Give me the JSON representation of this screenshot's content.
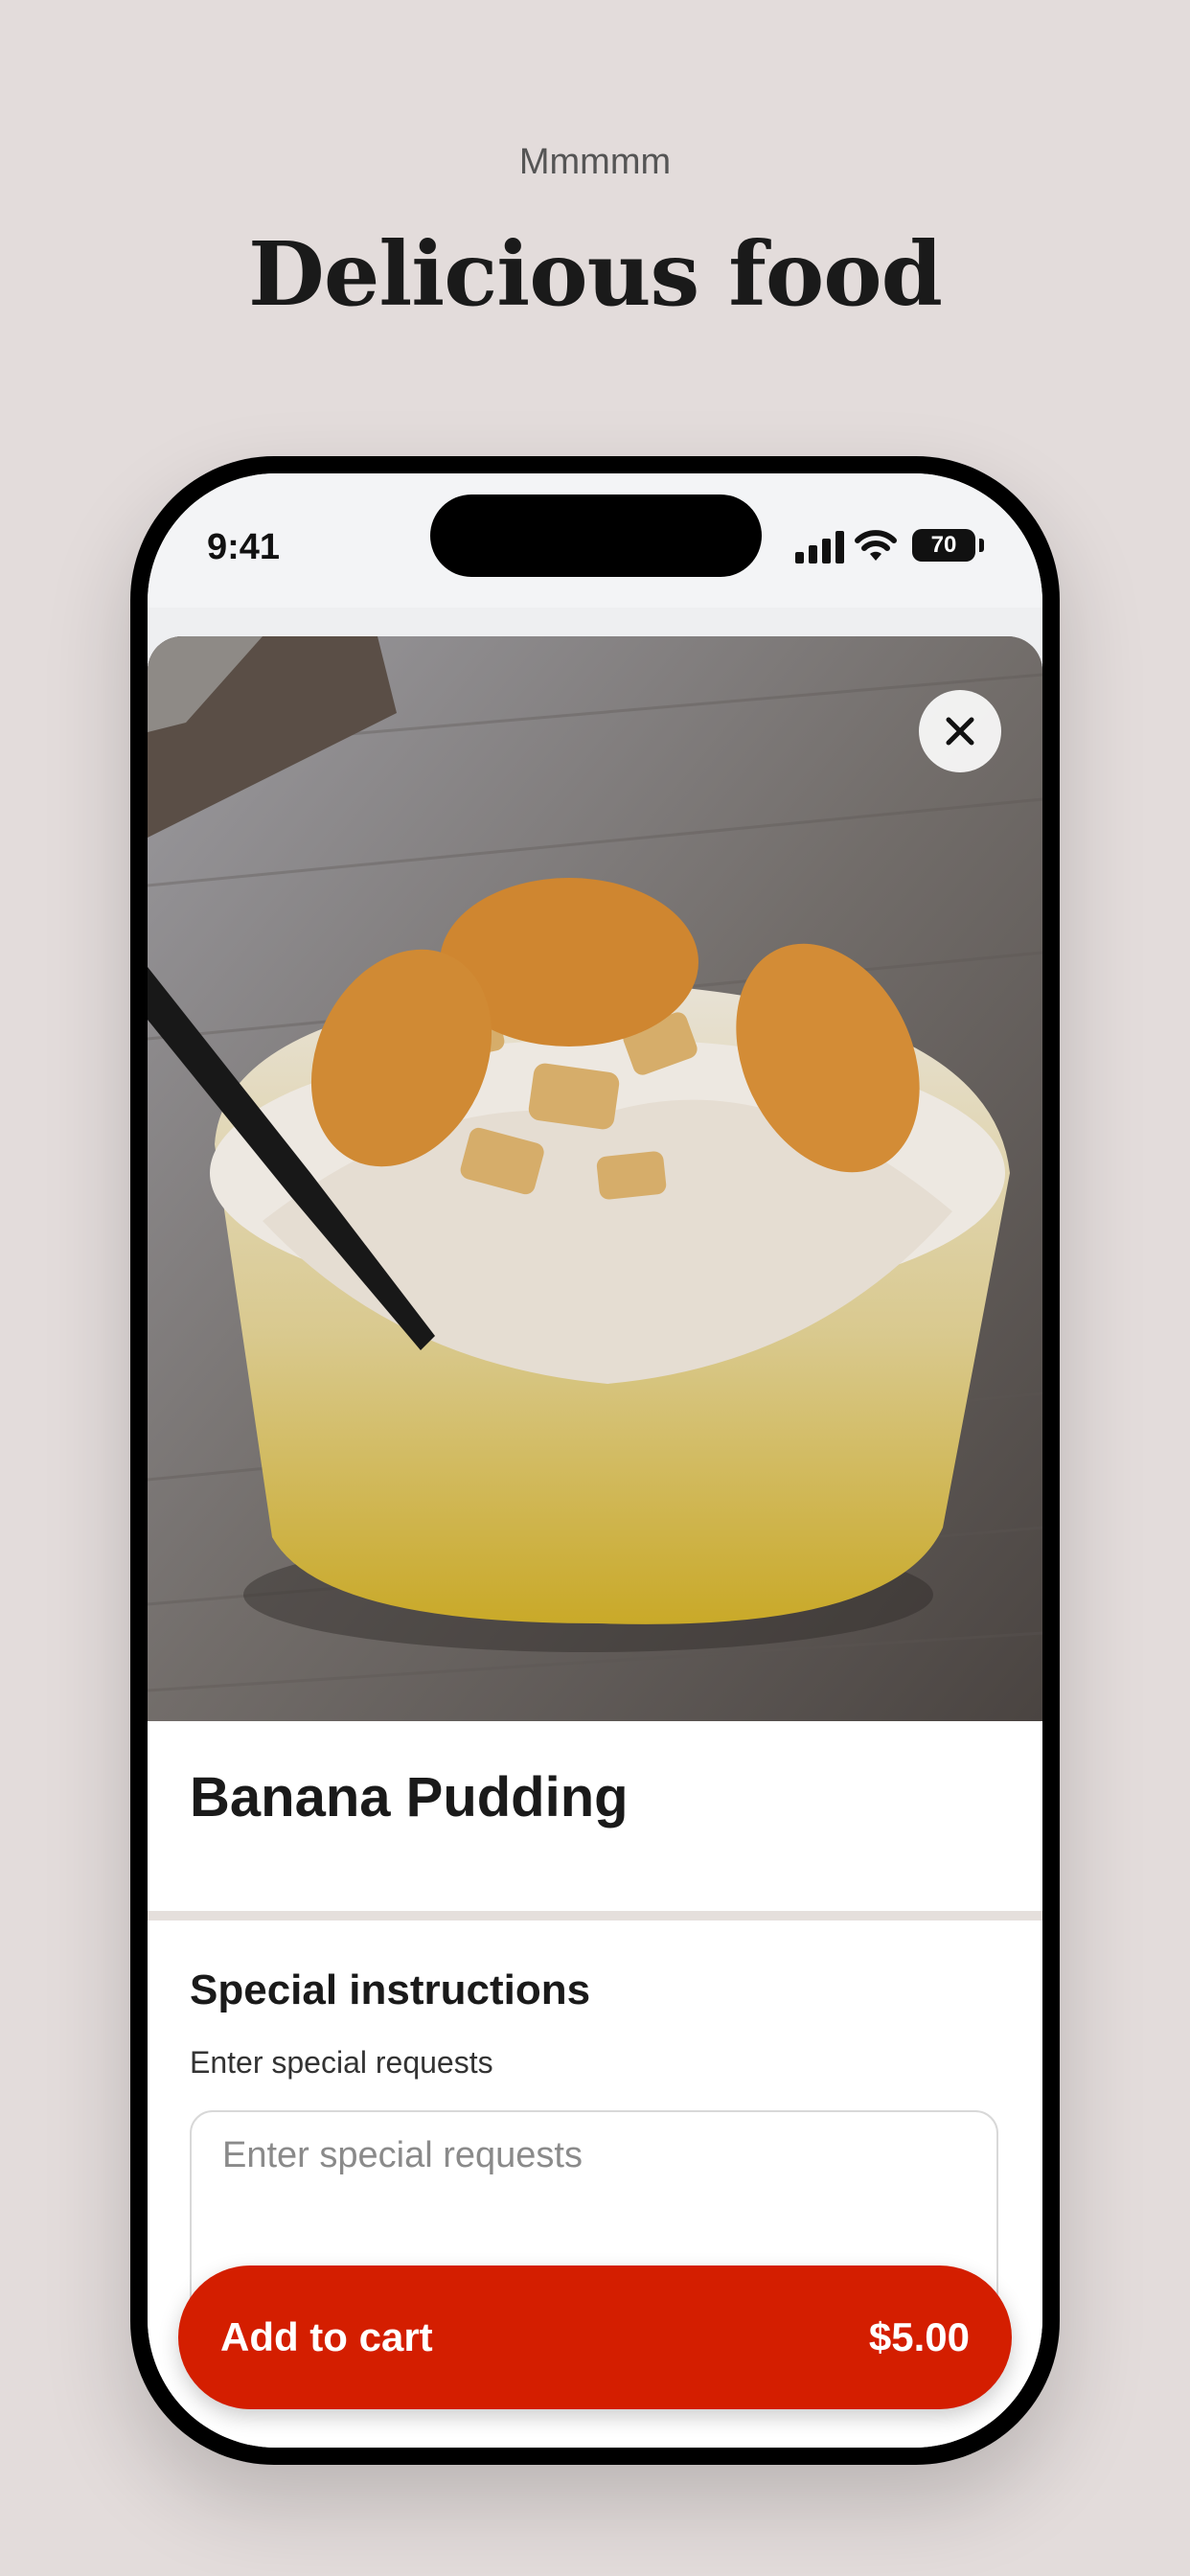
{
  "header": {
    "kicker": "Mmmmm",
    "headline": "Delicious food"
  },
  "status_bar": {
    "time": "9:41",
    "battery": "70"
  },
  "product": {
    "name": "Banana Pudding",
    "image_alt": "Banana pudding in a clear cup with vanilla wafers and a black fork"
  },
  "instructions": {
    "title": "Special instructions",
    "subtitle": "Enter special requests",
    "placeholder": "Enter special requests"
  },
  "cart_button": {
    "label": "Add to cart",
    "price": "$5.00"
  },
  "colors": {
    "background": "#e3dcdb",
    "accent": "#d41e00"
  },
  "icons": {
    "close": "close-icon",
    "signal": "cellular-signal-icon",
    "wifi": "wifi-icon",
    "battery": "battery-icon"
  }
}
